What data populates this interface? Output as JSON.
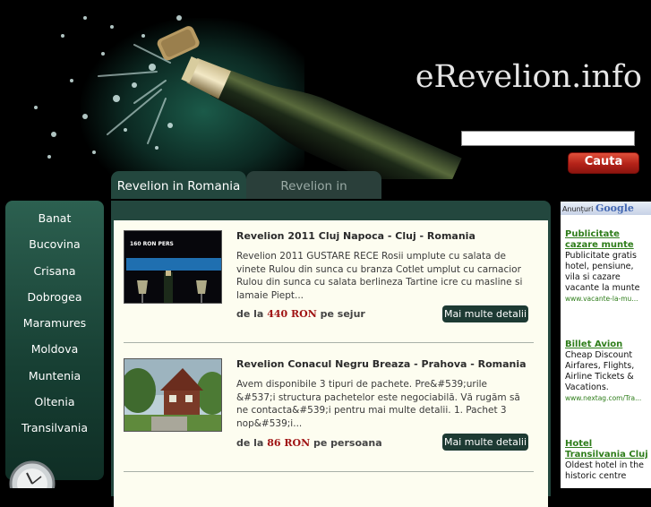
{
  "site": {
    "title": "eRevelion.info"
  },
  "search": {
    "value": "",
    "button_label": "Cauta"
  },
  "tabs": [
    {
      "label": "Revelion in Romania",
      "active": true
    },
    {
      "label": "Revelion in Strainatate",
      "active": false
    }
  ],
  "sidebar": {
    "items": [
      {
        "label": "Banat"
      },
      {
        "label": "Bucovina"
      },
      {
        "label": "Crisana"
      },
      {
        "label": "Dobrogea"
      },
      {
        "label": "Maramures"
      },
      {
        "label": "Moldova"
      },
      {
        "label": "Muntenia"
      },
      {
        "label": "Oltenia"
      },
      {
        "label": "Transilvania"
      }
    ]
  },
  "listings": [
    {
      "title": "Revelion 2011 Cluj Napoca - Cluj - Romania",
      "description": "Revelion 2011 GUSTARE RECE Rosii umplute cu salata de vinete Rulou din sunca cu branza Cotlet umplut cu carnacior Rulou din sunca cu salata berlineza Tartine icre cu masline si lamaie Piept...",
      "price_prefix": "de la",
      "price": "440 RON",
      "price_suffix": "pe sejur",
      "more_label": "Mai multe detalii",
      "thumb_text": "160 RON PERS"
    },
    {
      "title": "Revelion Conacul Negru Breaza - Prahova - Romania",
      "description": "Avem disponibile 3 tipuri de pachete. Pre&#539;urile &#537;i structura pachetelor este negociabilă. Vă rugăm să ne contacta&#539;i pentru mai multe detalii. 1. Pachet 3 nop&#539;i...",
      "price_prefix": "de la",
      "price": "86 RON",
      "price_suffix": "pe persoana",
      "more_label": "Mai multe detalii"
    }
  ],
  "ads": {
    "header_label": "Anunțuri",
    "header_brand": "Google",
    "items": [
      {
        "title": "Publicitate cazare munte",
        "text": "Publicitate gratis hotel, pensiune, vila si cazare vacante la munte",
        "url": "www.vacante-la-mu..."
      },
      {
        "title": "Billet Avion",
        "text": "Cheap Discount Airfares, Flights, Airline Tickets & Vacations.",
        "url": "www.nextag.com/Tra..."
      },
      {
        "title": "Hotel Transilvania Cluj",
        "text": "Oldest hotel in the historic centre",
        "url": ""
      }
    ]
  }
}
